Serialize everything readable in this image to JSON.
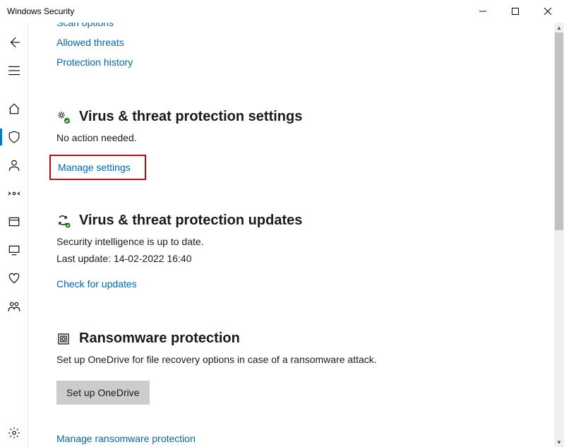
{
  "window": {
    "title": "Windows Security"
  },
  "links": {
    "scan_options": "Scan options",
    "allowed_threats": "Allowed threats",
    "protection_history": "Protection history",
    "manage_settings": "Manage settings",
    "check_updates": "Check for updates",
    "manage_ransomware": "Manage ransomware protection"
  },
  "sections": {
    "settings": {
      "title": "Virus & threat protection settings",
      "desc": "No action needed."
    },
    "updates": {
      "title": "Virus & threat protection updates",
      "desc": "Security intelligence is up to date.",
      "last_update": "Last update: 14-02-2022 16:40"
    },
    "ransomware": {
      "title": "Ransomware protection",
      "desc": "Set up OneDrive for file recovery options in case of a ransomware attack.",
      "button": "Set up OneDrive"
    }
  }
}
